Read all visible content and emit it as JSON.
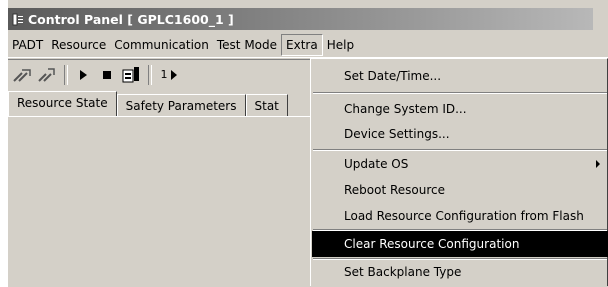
{
  "window": {
    "title": "Control Panel [ GPLC1600_1 ]"
  },
  "menubar": {
    "items": [
      "PADT",
      "Resource",
      "Communication",
      "Test Mode",
      "Extra",
      "Help"
    ],
    "open_index": 4
  },
  "toolbar": {
    "icons": [
      "connect-icon",
      "disconnect-icon",
      "play-icon",
      "stop-icon",
      "download-icon",
      "single-step-icon"
    ],
    "step_label": "1"
  },
  "tabs": {
    "items": [
      "Resource State",
      "Safety Parameters",
      "Stat"
    ]
  },
  "extra_menu": {
    "items": [
      {
        "label": "Set Date/Time...",
        "underline": "D"
      },
      {
        "label": "Change System ID...",
        "underline": "S"
      },
      {
        "label": "Device Settings...",
        "underline": "D"
      },
      {
        "label": "Update OS",
        "has_submenu": true
      },
      {
        "label": "Reboot Resource",
        "underline": "R"
      },
      {
        "label": "Load Resource Configuration from Flash",
        "underline": "F"
      },
      {
        "label": "Clear Resource Configuration",
        "highlighted": true
      },
      {
        "label": "Set Backplane Type",
        "underline": "B"
      }
    ]
  },
  "colors": {
    "menu_bg": "#d4d0c8",
    "highlight_bg": "#000000",
    "highlight_fg": "#ffffff"
  }
}
